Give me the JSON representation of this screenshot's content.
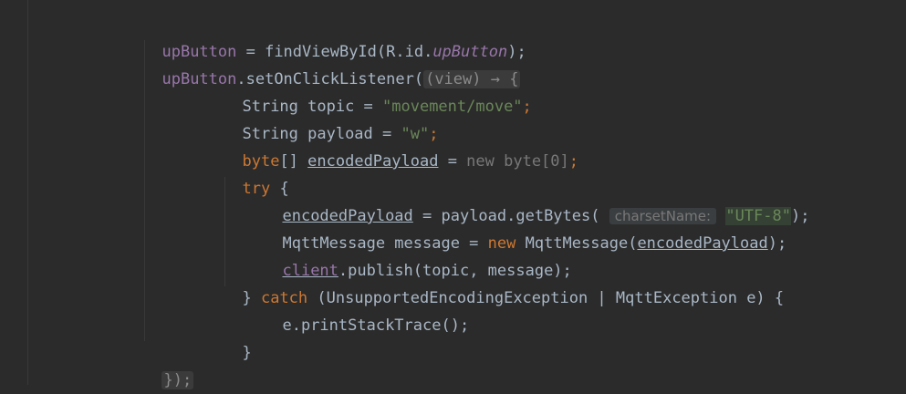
{
  "l1": {
    "a": "upButton",
    "b": " = findViewById(R.id.",
    "c": "upButton",
    "d": ");"
  },
  "l2": {
    "a": "upButton",
    ".": ".setOnClickListener(",
    "lam": "(view) → {"
  },
  "l3": {
    "a": "String topic = ",
    "s": "\"movement/move\"",
    "e": ";"
  },
  "l4": {
    "a": "String payload = ",
    "s": "\"w\"",
    "e": ";"
  },
  "l5": {
    "kw": "byte",
    "a": "[] ",
    "v": "encodedPayload",
    "b": " = ",
    "dim": "new byte[0]",
    "e": ";"
  },
  "l6": {
    "kw": "try",
    "a": " {"
  },
  "l7": {
    "v": "encodedPayload",
    "a": " = payload.getBytes( ",
    "hint": "charsetName:",
    "s": "\"UTF-8\"",
    "e": ");"
  },
  "l8": {
    "a": "MqttMessage message = ",
    "kw": "new",
    "b": " MqttMessage(",
    "v": "encodedPayload",
    "e": ");"
  },
  "l9": {
    "f": "client",
    "a": ".publish(topic, message);"
  },
  "l10": {
    "a": "} ",
    "kw": "catch",
    "b": " (UnsupportedEncodingException | MqttException e) {"
  },
  "l11": {
    "a": "e.printStackTrace();"
  },
  "l12": {
    "a": "}"
  },
  "l13": {
    "a": "});"
  }
}
